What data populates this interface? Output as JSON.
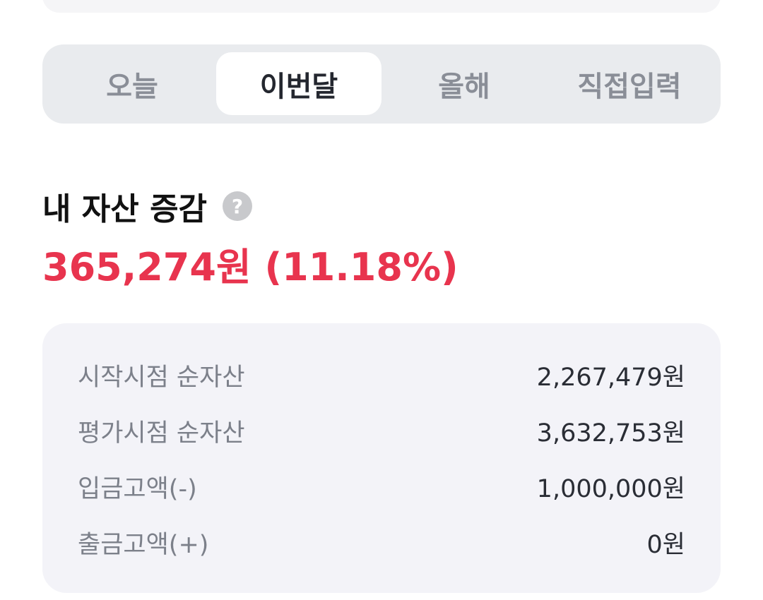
{
  "period_tabs": [
    {
      "label": "오늘",
      "active": false
    },
    {
      "label": "이번달",
      "active": true
    },
    {
      "label": "올해",
      "active": false
    },
    {
      "label": "직접입력",
      "active": false
    }
  ],
  "asset_change": {
    "title": "내 자산 증감",
    "help_icon": "question-icon",
    "help_glyph": "?",
    "amount": "365,274원",
    "percent": "(11.18%)",
    "accent_color": "#e8344e"
  },
  "details": [
    {
      "label": "시작시점 순자산",
      "value": "2,267,479원"
    },
    {
      "label": "평가시점 순자산",
      "value": "3,632,753원"
    },
    {
      "label": "입금고액(-)",
      "value": "1,000,000원"
    },
    {
      "label": "출금고액(+)",
      "value": "0원"
    }
  ]
}
